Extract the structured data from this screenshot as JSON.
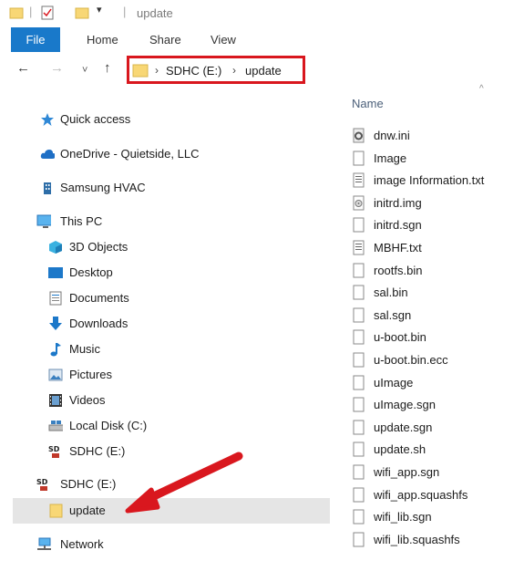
{
  "window": {
    "title": "update"
  },
  "ribbon": {
    "tabs": [
      "File",
      "Home",
      "Share",
      "View"
    ]
  },
  "address": {
    "segments": [
      "SDHC (E:)",
      "update"
    ]
  },
  "nav": {
    "items": [
      {
        "label": "Quick access",
        "icon": "star-icon"
      },
      {
        "label": "OneDrive - Quietside, LLC",
        "icon": "cloud-icon"
      },
      {
        "label": "Samsung HVAC",
        "icon": "building-icon"
      },
      {
        "label": "This PC",
        "icon": "monitor-icon"
      },
      {
        "label": "3D Objects",
        "icon": "cube-icon"
      },
      {
        "label": "Desktop",
        "icon": "desktop-icon"
      },
      {
        "label": "Documents",
        "icon": "document-icon"
      },
      {
        "label": "Downloads",
        "icon": "download-icon"
      },
      {
        "label": "Music",
        "icon": "music-icon"
      },
      {
        "label": "Pictures",
        "icon": "pictures-icon"
      },
      {
        "label": "Videos",
        "icon": "video-icon"
      },
      {
        "label": "Local Disk (C:)",
        "icon": "drive-icon"
      },
      {
        "label": "SDHC (E:)",
        "icon": "sd-card-icon"
      },
      {
        "label": "SDHC (E:)",
        "icon": "sd-card-icon"
      },
      {
        "label": "update",
        "icon": "folder-icon"
      },
      {
        "label": "Network",
        "icon": "network-icon"
      }
    ]
  },
  "files": {
    "column": "Name",
    "items": [
      "dnw.ini",
      "Image",
      "image Information.txt",
      "initrd.img",
      "initrd.sgn",
      "MBHF.txt",
      "rootfs.bin",
      "sal.bin",
      "sal.sgn",
      "u-boot.bin",
      "u-boot.bin.ecc",
      "uImage",
      "uImage.sgn",
      "update.sgn",
      "update.sh",
      "wifi_app.sgn",
      "wifi_app.squashfs",
      "wifi_lib.sgn",
      "wifi_lib.squashfs"
    ]
  },
  "colors": {
    "accent": "#1979ca",
    "highlight": "#d9171e",
    "folder": "#f8d775",
    "selected": "#e5e5e5"
  }
}
